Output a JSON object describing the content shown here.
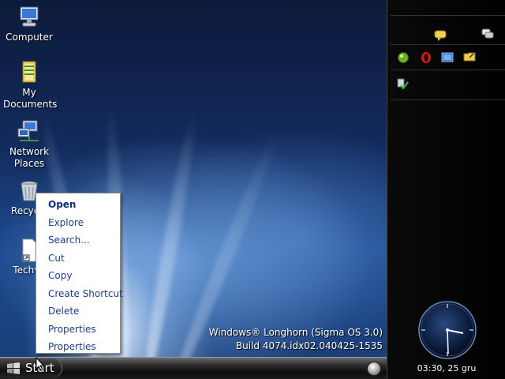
{
  "desktop": {
    "icons": [
      {
        "label": "Computer"
      },
      {
        "label": "My Documents"
      },
      {
        "label": "Network Places"
      },
      {
        "label": "Recycle"
      },
      {
        "label": "Techvo"
      }
    ],
    "watermark": {
      "line1": "Windows® Longhorn (Sigma OS 3.0)",
      "line2": "Build 4074.idx02.040425-1535"
    }
  },
  "context_menu": {
    "items": [
      {
        "label": "Open",
        "bold": true
      },
      {
        "label": "Explore"
      },
      {
        "label": "Search..."
      },
      {
        "label": "Cut"
      },
      {
        "label": "Copy"
      },
      {
        "label": "Create Shortcut"
      },
      {
        "label": "Delete"
      },
      {
        "label": "Properties"
      },
      {
        "label": "Properties"
      }
    ]
  },
  "taskbar": {
    "start_label": "Start"
  },
  "sidebar": {
    "clock_text": "03:30, 25 gru",
    "tile_icons": [
      "chat-bubble-icon",
      "messenger-icon",
      "green-orb-icon",
      "opera-icon",
      "screen-icon",
      "folder-note-icon",
      "security-check-icon"
    ]
  }
}
